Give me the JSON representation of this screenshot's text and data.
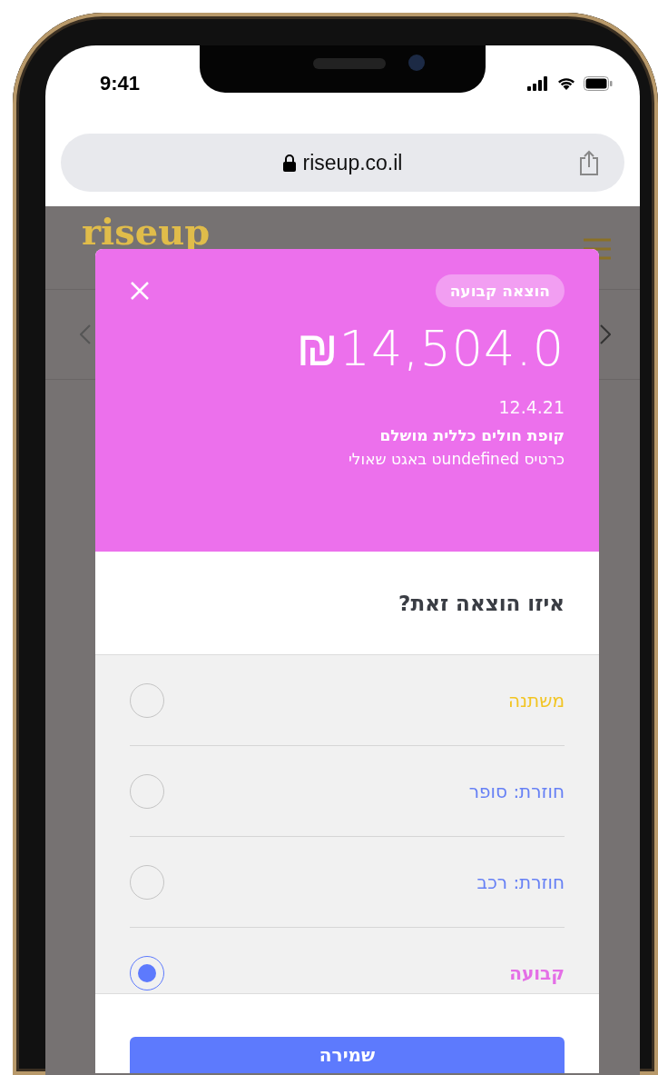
{
  "status_bar": {
    "time": "9:41"
  },
  "browser": {
    "url": "riseup.co.il"
  },
  "site": {
    "logo": "riseup"
  },
  "modal": {
    "tag": "הוצאה קבועה",
    "amount": "₪14,504.0",
    "date": "12.4.21",
    "merchant": "קופת חולים כללית מושלם",
    "source": "כרטיס undefinedט באגט שאולי",
    "question": "איזו הוצאה זאת?",
    "options": [
      {
        "label": "משתנה",
        "color": "#f2c523",
        "selected": false
      },
      {
        "label": "חוזרת: סופר",
        "color": "#6680f5",
        "selected": false
      },
      {
        "label": "חוזרת: רכב",
        "color": "#6680f5",
        "selected": false
      },
      {
        "label": "קבועה",
        "color": "#e46fe6",
        "selected": true
      }
    ],
    "save_button": "שמירה"
  }
}
